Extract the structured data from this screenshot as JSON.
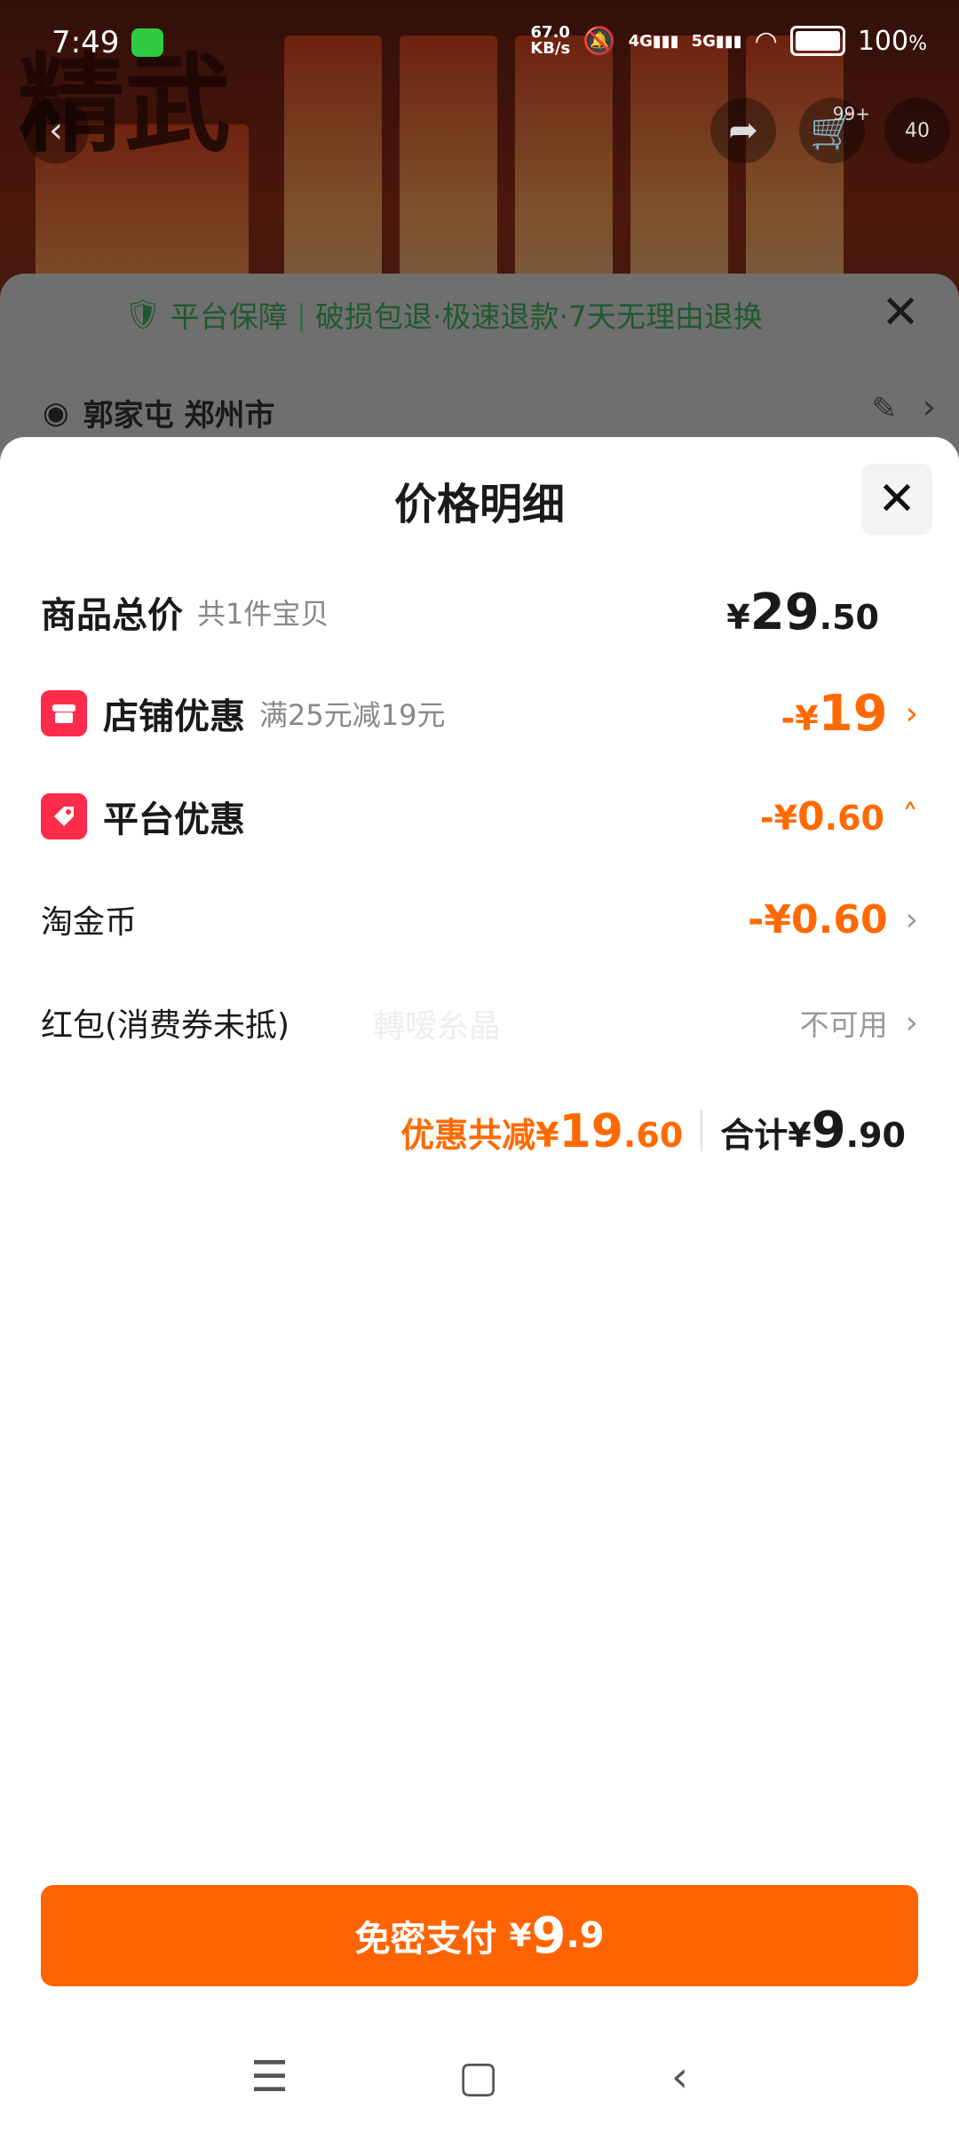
{
  "status_bar": {
    "time": "7:49",
    "netspeed_value": "67.0",
    "netspeed_unit": "KB/s",
    "signal1": "4G",
    "signal2": "5G",
    "battery": "100",
    "battery_unit": "%"
  },
  "background": {
    "brand": "精武",
    "cart_count": "99+",
    "extra_badge": "40"
  },
  "underlying_sheet": {
    "guarantee_title": "平台保障",
    "guarantee_text": "破损包退·极速退款·7天无理由退换",
    "address": "郭家屯 郑州市"
  },
  "price_detail": {
    "title": "价格明细",
    "total": {
      "label": "商品总价",
      "sub": "共1件宝贝",
      "yen": "¥",
      "int": "29",
      "dec": ".50"
    },
    "store_discount": {
      "label": "店铺优惠",
      "sub": "满25元减19元",
      "prefix": "-¥",
      "int": "19"
    },
    "platform_discount": {
      "label": "平台优惠",
      "prefix": "-¥",
      "int": "0",
      "dec": ".60"
    },
    "coins": {
      "label": "淘金币",
      "value": "-¥0.60"
    },
    "red_packet": {
      "label": "红包(消费券未抵)",
      "watermark": "轉嗳糸晶",
      "status": "不可用"
    },
    "summary": {
      "saved_label": "优惠共减",
      "saved_yen": "¥",
      "saved_int": "19",
      "saved_dec": ".60",
      "total_label": "合计",
      "total_yen": "¥",
      "total_int": "9",
      "total_dec": ".90"
    }
  },
  "pay_button": {
    "label": "免密支付",
    "yen": "¥",
    "int": "9",
    "dec": ".9"
  },
  "colors": {
    "accent": "#ff6400",
    "badge": "#ff2b4a",
    "text": "#1a1a1a"
  }
}
